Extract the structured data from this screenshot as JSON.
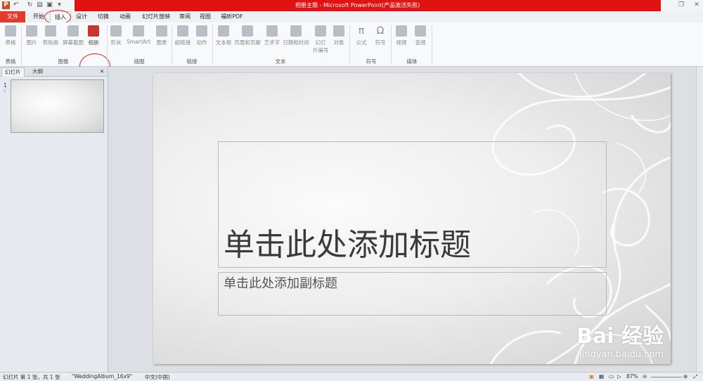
{
  "window": {
    "title": "相册主题 - Microsoft PowerPoint(产品激活失败)",
    "quick_access": [
      "undo-icon",
      "redo-icon",
      "customize-icon",
      "save-icon",
      "dropdown-icon"
    ]
  },
  "tabs": [
    {
      "label": "文件"
    },
    {
      "label": "开始"
    },
    {
      "label": "插入"
    },
    {
      "label": "设计"
    },
    {
      "label": "切换"
    },
    {
      "label": "动画"
    },
    {
      "label": "幻灯片放映"
    },
    {
      "label": "审阅"
    },
    {
      "label": "视图"
    },
    {
      "label": "福昕PDF"
    }
  ],
  "ribbon": {
    "buttons": {
      "table": "表格",
      "picture": "图片",
      "clipart": "剪贴画",
      "screenshot": "屏幕截图",
      "album": "相册",
      "shape": "形状",
      "smartart": "SmartArt",
      "chart": "图表",
      "hyperlink": "超链接",
      "action": "动作",
      "textbox": "文本框",
      "headerfooter": "页眉和页脚",
      "wordart": "艺术字",
      "datetime": "日期和时间",
      "slidenum1": "幻灯",
      "slidenum2": "片编号",
      "object": "对象",
      "equation": "公式",
      "symbol": "符号",
      "video": "视频",
      "audio": "音频"
    },
    "groups": {
      "tables": "表格",
      "images": "图像",
      "illustrations": "插图",
      "links": "链接",
      "text": "文本",
      "symbols": "符号",
      "media": "媒体"
    }
  },
  "left_pane": {
    "tabs": [
      "幻灯片",
      "大纲"
    ],
    "slide_number": "1"
  },
  "slide": {
    "title_placeholder": "单击此处添加标题",
    "subtitle_placeholder": "单击此处添加副标题"
  },
  "watermark": {
    "logo": "Bai 经验",
    "url": "jingyan.baidu.com"
  },
  "status": {
    "slide_info": "幻灯片 第 1 张，共 1 张",
    "theme": "\"WeddingAlbum_16x9\"",
    "language": "中文(中国)",
    "zoom": "87%"
  },
  "colors": {
    "title_bar_accent": "#e01212",
    "file_tab": "#e33b2e",
    "annotation": "#e02020"
  }
}
